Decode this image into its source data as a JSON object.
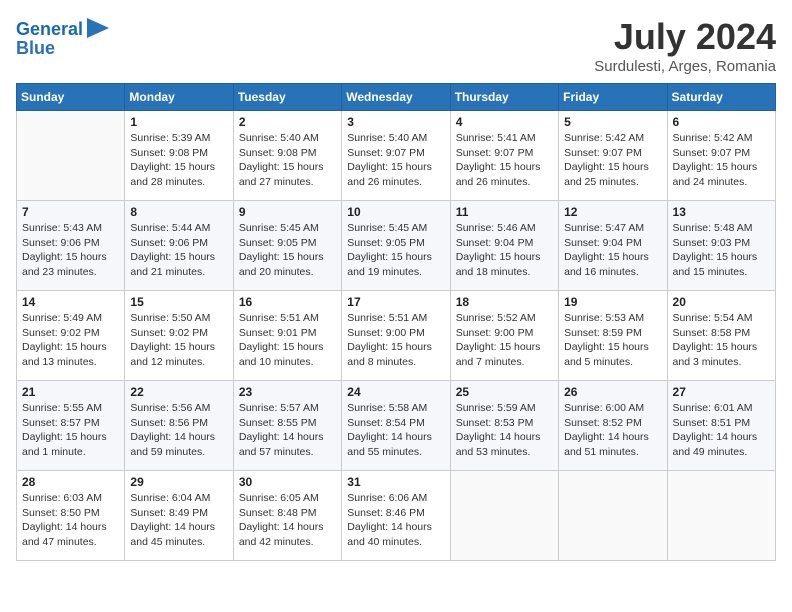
{
  "header": {
    "logo_line1": "General",
    "logo_line2": "Blue",
    "month_year": "July 2024",
    "location": "Surdulesti, Arges, Romania"
  },
  "days_of_week": [
    "Sunday",
    "Monday",
    "Tuesday",
    "Wednesday",
    "Thursday",
    "Friday",
    "Saturday"
  ],
  "weeks": [
    [
      {
        "day": "",
        "info": ""
      },
      {
        "day": "1",
        "info": "Sunrise: 5:39 AM\nSunset: 9:08 PM\nDaylight: 15 hours\nand 28 minutes."
      },
      {
        "day": "2",
        "info": "Sunrise: 5:40 AM\nSunset: 9:08 PM\nDaylight: 15 hours\nand 27 minutes."
      },
      {
        "day": "3",
        "info": "Sunrise: 5:40 AM\nSunset: 9:07 PM\nDaylight: 15 hours\nand 26 minutes."
      },
      {
        "day": "4",
        "info": "Sunrise: 5:41 AM\nSunset: 9:07 PM\nDaylight: 15 hours\nand 26 minutes."
      },
      {
        "day": "5",
        "info": "Sunrise: 5:42 AM\nSunset: 9:07 PM\nDaylight: 15 hours\nand 25 minutes."
      },
      {
        "day": "6",
        "info": "Sunrise: 5:42 AM\nSunset: 9:07 PM\nDaylight: 15 hours\nand 24 minutes."
      }
    ],
    [
      {
        "day": "7",
        "info": "Sunrise: 5:43 AM\nSunset: 9:06 PM\nDaylight: 15 hours\nand 23 minutes."
      },
      {
        "day": "8",
        "info": "Sunrise: 5:44 AM\nSunset: 9:06 PM\nDaylight: 15 hours\nand 21 minutes."
      },
      {
        "day": "9",
        "info": "Sunrise: 5:45 AM\nSunset: 9:05 PM\nDaylight: 15 hours\nand 20 minutes."
      },
      {
        "day": "10",
        "info": "Sunrise: 5:45 AM\nSunset: 9:05 PM\nDaylight: 15 hours\nand 19 minutes."
      },
      {
        "day": "11",
        "info": "Sunrise: 5:46 AM\nSunset: 9:04 PM\nDaylight: 15 hours\nand 18 minutes."
      },
      {
        "day": "12",
        "info": "Sunrise: 5:47 AM\nSunset: 9:04 PM\nDaylight: 15 hours\nand 16 minutes."
      },
      {
        "day": "13",
        "info": "Sunrise: 5:48 AM\nSunset: 9:03 PM\nDaylight: 15 hours\nand 15 minutes."
      }
    ],
    [
      {
        "day": "14",
        "info": "Sunrise: 5:49 AM\nSunset: 9:02 PM\nDaylight: 15 hours\nand 13 minutes."
      },
      {
        "day": "15",
        "info": "Sunrise: 5:50 AM\nSunset: 9:02 PM\nDaylight: 15 hours\nand 12 minutes."
      },
      {
        "day": "16",
        "info": "Sunrise: 5:51 AM\nSunset: 9:01 PM\nDaylight: 15 hours\nand 10 minutes."
      },
      {
        "day": "17",
        "info": "Sunrise: 5:51 AM\nSunset: 9:00 PM\nDaylight: 15 hours\nand 8 minutes."
      },
      {
        "day": "18",
        "info": "Sunrise: 5:52 AM\nSunset: 9:00 PM\nDaylight: 15 hours\nand 7 minutes."
      },
      {
        "day": "19",
        "info": "Sunrise: 5:53 AM\nSunset: 8:59 PM\nDaylight: 15 hours\nand 5 minutes."
      },
      {
        "day": "20",
        "info": "Sunrise: 5:54 AM\nSunset: 8:58 PM\nDaylight: 15 hours\nand 3 minutes."
      }
    ],
    [
      {
        "day": "21",
        "info": "Sunrise: 5:55 AM\nSunset: 8:57 PM\nDaylight: 15 hours\nand 1 minute."
      },
      {
        "day": "22",
        "info": "Sunrise: 5:56 AM\nSunset: 8:56 PM\nDaylight: 14 hours\nand 59 minutes."
      },
      {
        "day": "23",
        "info": "Sunrise: 5:57 AM\nSunset: 8:55 PM\nDaylight: 14 hours\nand 57 minutes."
      },
      {
        "day": "24",
        "info": "Sunrise: 5:58 AM\nSunset: 8:54 PM\nDaylight: 14 hours\nand 55 minutes."
      },
      {
        "day": "25",
        "info": "Sunrise: 5:59 AM\nSunset: 8:53 PM\nDaylight: 14 hours\nand 53 minutes."
      },
      {
        "day": "26",
        "info": "Sunrise: 6:00 AM\nSunset: 8:52 PM\nDaylight: 14 hours\nand 51 minutes."
      },
      {
        "day": "27",
        "info": "Sunrise: 6:01 AM\nSunset: 8:51 PM\nDaylight: 14 hours\nand 49 minutes."
      }
    ],
    [
      {
        "day": "28",
        "info": "Sunrise: 6:03 AM\nSunset: 8:50 PM\nDaylight: 14 hours\nand 47 minutes."
      },
      {
        "day": "29",
        "info": "Sunrise: 6:04 AM\nSunset: 8:49 PM\nDaylight: 14 hours\nand 45 minutes."
      },
      {
        "day": "30",
        "info": "Sunrise: 6:05 AM\nSunset: 8:48 PM\nDaylight: 14 hours\nand 42 minutes."
      },
      {
        "day": "31",
        "info": "Sunrise: 6:06 AM\nSunset: 8:46 PM\nDaylight: 14 hours\nand 40 minutes."
      },
      {
        "day": "",
        "info": ""
      },
      {
        "day": "",
        "info": ""
      },
      {
        "day": "",
        "info": ""
      }
    ]
  ]
}
